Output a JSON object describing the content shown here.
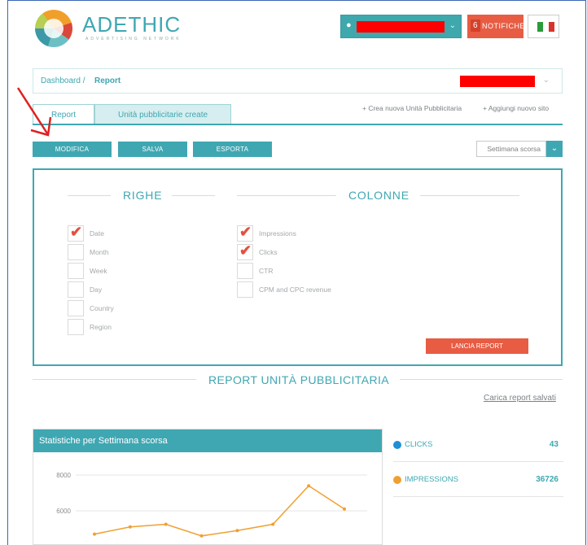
{
  "header": {
    "logo_text": "ADETHIC",
    "logo_tagline": "ADVERTISING NETWORK",
    "user_chevron": "⌄",
    "notifications": {
      "count": "6",
      "label": "NOTIFICHE"
    }
  },
  "breadcrumb": {
    "home": "Dashboard /",
    "current": "Report"
  },
  "tabs": [
    {
      "label": "Report",
      "active": true
    },
    {
      "label": "Unità pubblicitarie create",
      "active": false
    }
  ],
  "actions": {
    "new_unit": "+ Crea nuova Unità Pubblicitaria",
    "new_site": "+ Aggiungi nuovo sito"
  },
  "toolbar": {
    "edit": "MODIFICA",
    "save": "SALVA",
    "export": "ESPORTA"
  },
  "period_select": {
    "value": "Settimana scorsa"
  },
  "report_builder": {
    "rows_title": "RIGHE",
    "columns_title": "COLONNE",
    "rows": [
      {
        "label": "Date",
        "checked": true
      },
      {
        "label": "Month",
        "checked": false
      },
      {
        "label": "Week",
        "checked": false
      },
      {
        "label": "Day",
        "checked": false
      },
      {
        "label": "Country",
        "checked": false
      },
      {
        "label": "Region",
        "checked": false
      }
    ],
    "columns": [
      {
        "label": "Impressions",
        "checked": true
      },
      {
        "label": "Clicks",
        "checked": true
      },
      {
        "label": "CTR",
        "checked": false
      },
      {
        "label": "CPM and CPC revenue",
        "checked": false
      }
    ],
    "run_button": "LANCIA REPORT"
  },
  "report_section": {
    "title": "REPORT UNITÀ PUBBLICITARIA",
    "load_saved": "Carica report salvati"
  },
  "chart_panel": {
    "title": "Statistiche per Settimana scorsa"
  },
  "stats": [
    {
      "label": "CLICKS",
      "value": "43",
      "color": "#1f8fd6"
    },
    {
      "label": "IMPRESSIONS",
      "value": "36726",
      "color": "#f0a030"
    }
  ],
  "chart_data": {
    "type": "line",
    "title": "Statistiche per Settimana scorsa",
    "y_ticks": [
      "8000",
      "6000"
    ],
    "series": [
      {
        "color": "#f0a030",
        "values": [
          4700,
          5100,
          5250,
          4600,
          4900,
          5250,
          7400,
          6100
        ]
      }
    ],
    "ylim": [
      4400,
      8500
    ]
  },
  "colors": {
    "accent": "#3fa7b2",
    "danger": "#e85c43",
    "annotation_arrow": "#e02020"
  }
}
